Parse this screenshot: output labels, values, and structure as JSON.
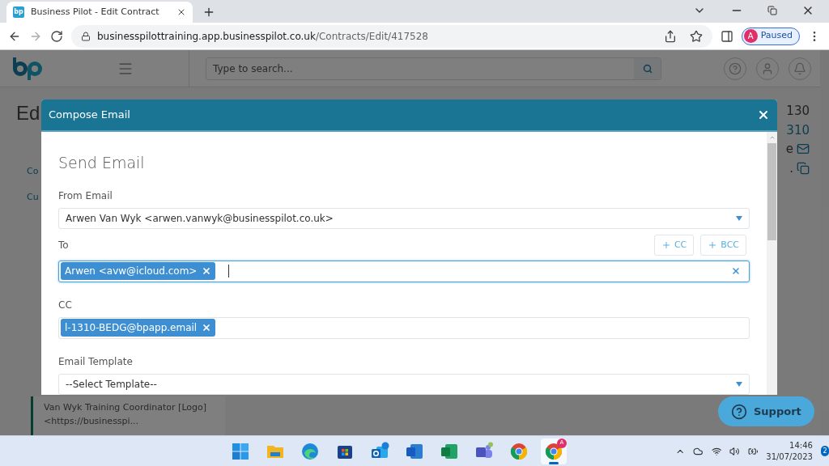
{
  "browser": {
    "tab": {
      "title": "Business Pilot - Edit Contract",
      "logo": "bp"
    },
    "url_host": "businesspilottraining.app.businesspilot.co.uk",
    "url_path": "/Contracts/Edit/417528",
    "profile": {
      "initial": "A",
      "status": "Paused"
    }
  },
  "app": {
    "search": {
      "placeholder": "Type to search..."
    },
    "page_title": "Ed",
    "links": [
      "Co",
      "Cu"
    ],
    "right_texts": [
      "130",
      "310",
      "e",
      "."
    ],
    "note_lines": [
      "Van Wyk Training Coordinator [Logo]",
      "<https://businesspi..."
    ]
  },
  "modal": {
    "title": "Compose Email",
    "heading": "Send Email",
    "from": {
      "label": "From Email",
      "value": "Arwen Van Wyk <arwen.vanwyk@businesspilot.co.uk>"
    },
    "to": {
      "label": "To",
      "focused": true,
      "chips": [
        "Arwen <avw@icloud.com>"
      ]
    },
    "add_buttons": [
      "CC",
      "BCC"
    ],
    "cc": {
      "label": "CC",
      "focused": false,
      "chips": [
        "l-1310-BEDG@bpapp.email"
      ]
    },
    "template": {
      "label": "Email Template",
      "value": "--Select Template--"
    }
  },
  "support": {
    "label": "Support"
  },
  "taskbar": {
    "apps": [
      {
        "kind": "start",
        "active": false
      },
      {
        "kind": "folder",
        "active": false
      },
      {
        "kind": "edge",
        "active": false
      },
      {
        "kind": "store",
        "active": false
      },
      {
        "kind": "outlook",
        "active": false
      },
      {
        "kind": "word",
        "active": false
      },
      {
        "kind": "excel",
        "active": false
      },
      {
        "kind": "teams",
        "active": false
      },
      {
        "kind": "chrome",
        "active": false
      },
      {
        "kind": "chrome",
        "active": true,
        "badge": "A"
      }
    ],
    "time": "14:46",
    "date": "31/07/2023",
    "notifications": "2"
  }
}
